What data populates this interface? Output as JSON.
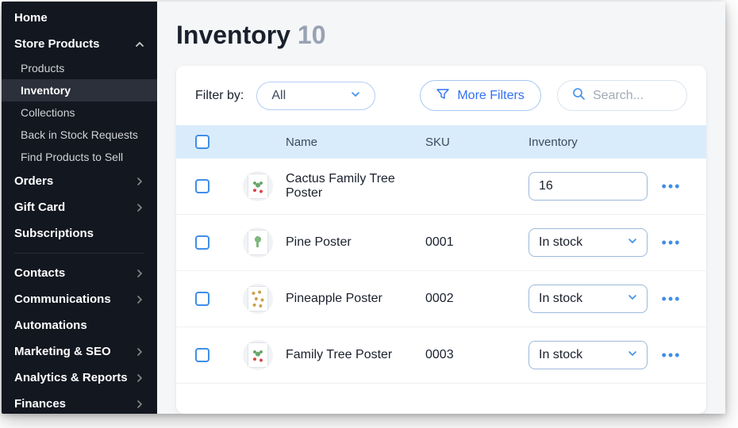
{
  "sidebar": {
    "home": "Home",
    "store_products": "Store Products",
    "subs": [
      "Products",
      "Inventory",
      "Collections",
      "Back in Stock Requests",
      "Find Products to Sell"
    ],
    "active_sub_index": 1,
    "orders": "Orders",
    "gift_card": "Gift Card",
    "subscriptions": "Subscriptions",
    "contacts": "Contacts",
    "communications": "Communications",
    "automations": "Automations",
    "marketing": "Marketing & SEO",
    "analytics": "Analytics & Reports",
    "finances": "Finances"
  },
  "header": {
    "title": "Inventory",
    "count": "10"
  },
  "filter": {
    "label": "Filter by:",
    "selected": "All",
    "more": "More Filters",
    "search_placeholder": "Search..."
  },
  "columns": {
    "name": "Name",
    "sku": "SKU",
    "inventory": "Inventory"
  },
  "rows": [
    {
      "name": "Cactus Family Tree Poster",
      "sku": "",
      "inventory_type": "number",
      "inventory": "16",
      "thumb": "cactus"
    },
    {
      "name": "Pine Poster",
      "sku": "0001",
      "inventory_type": "select",
      "inventory": "In stock",
      "thumb": "pine"
    },
    {
      "name": "Pineapple Poster",
      "sku": "0002",
      "inventory_type": "select",
      "inventory": "In stock",
      "thumb": "pineapple"
    },
    {
      "name": "Family Tree Poster",
      "sku": "0003",
      "inventory_type": "select",
      "inventory": "In stock",
      "thumb": "tree"
    }
  ]
}
